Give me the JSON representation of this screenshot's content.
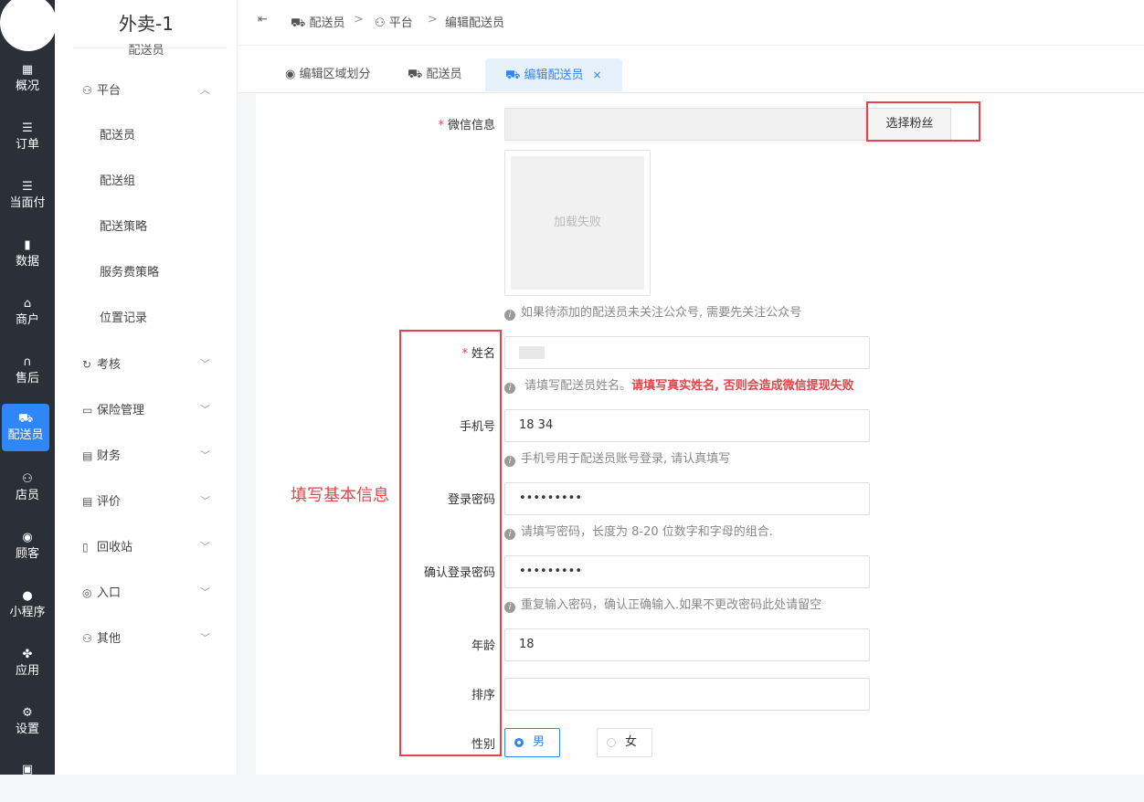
{
  "rail": {
    "items": [
      {
        "label": "概况",
        "icon": "dashboard-icon"
      },
      {
        "label": "订单",
        "icon": "list-icon"
      },
      {
        "label": "当面付",
        "icon": "list-icon"
      },
      {
        "label": "数据",
        "icon": "bar-chart-icon"
      },
      {
        "label": "商户",
        "icon": "store-icon"
      },
      {
        "label": "售后",
        "icon": "headset-icon"
      },
      {
        "label": "配送员",
        "icon": "delivery-icon"
      },
      {
        "label": "店员",
        "icon": "users-icon"
      },
      {
        "label": "顾客",
        "icon": "user-circle-icon"
      },
      {
        "label": "小程序",
        "icon": "wechat-icon"
      },
      {
        "label": "应用",
        "icon": "apps-icon"
      },
      {
        "label": "设置",
        "icon": "settings-user-icon"
      }
    ],
    "active_index": 6
  },
  "sidebar": {
    "title": "外卖-1",
    "subtitle": "配送员",
    "groups": [
      {
        "label": "平台",
        "expanded": true,
        "items": [
          "配送员",
          "配送组",
          "配送策略",
          "服务费策略",
          "位置记录"
        ]
      },
      {
        "label": "考核"
      },
      {
        "label": "保险管理"
      },
      {
        "label": "财务"
      },
      {
        "label": "评价"
      },
      {
        "label": "回收站"
      },
      {
        "label": "入口"
      },
      {
        "label": "其他"
      }
    ]
  },
  "breadcrumb": [
    "配送员",
    "平台",
    "编辑配送员"
  ],
  "tabs": [
    {
      "label": "编辑区域划分"
    },
    {
      "label": "配送员"
    },
    {
      "label": "编辑配送员",
      "close": "×",
      "active": true
    }
  ],
  "form": {
    "wechat": {
      "label": "微信信息",
      "button": "选择粉丝",
      "image_failed": "加载失败",
      "hint": "如果待添加的配送员未关注公众号, 需要先关注公众号"
    },
    "name": {
      "label": "姓名",
      "value": "",
      "hint": "请填写配送员姓名。",
      "hint_red": "请填写真实姓名, 否则会造成微信提现失败"
    },
    "phone": {
      "label": "手机号",
      "value": "18        34",
      "hint": "手机号用于配送员账号登录, 请认真填写"
    },
    "password": {
      "label": "登录密码",
      "value": "•••••••••",
      "hint": "请填写密码，长度为 8-20 位数字和字母的组合."
    },
    "confirm": {
      "label": "确认登录密码",
      "value": "•••••••••",
      "hint": "重复输入密码，确认正确输入.如果不更改密码此处请留空"
    },
    "age": {
      "label": "年龄",
      "value": "18"
    },
    "sort": {
      "label": "排序",
      "value": ""
    },
    "gender": {
      "label": "性别",
      "options": [
        "男",
        "女"
      ],
      "selected": "男"
    }
  },
  "annotation": "填写基本信息",
  "colors": {
    "accent": "#2f86f6",
    "rail": "#2b2f37",
    "annotation": "#e3434b"
  }
}
